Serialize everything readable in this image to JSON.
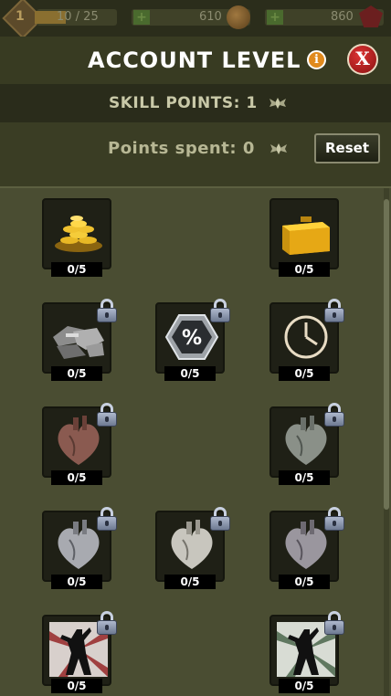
{
  "topbar": {
    "level": "1",
    "xp": "10 / 25",
    "coins": "610",
    "gems": "860"
  },
  "header": {
    "title": "ACCOUNT LEVEL",
    "info_glyph": "i",
    "close_glyph": "X"
  },
  "skill_points": {
    "label": "SKILL POINTS: 1"
  },
  "points_spent": {
    "label": "Points spent: 0",
    "reset_label": "Reset"
  },
  "skills": [
    {
      "icon": "gold-coins-icon",
      "count": "0/5",
      "locked": false
    },
    {
      "icon": "gold-crate-icon",
      "count": "0/5",
      "locked": false
    },
    {
      "icon": "scrap-metal-icon",
      "count": "0/5",
      "locked": true
    },
    {
      "icon": "percent-hexagon-icon",
      "count": "0/5",
      "locked": true
    },
    {
      "icon": "clock-icon",
      "count": "0/5",
      "locked": true
    },
    {
      "icon": "heart-bronze-icon",
      "count": "0/5",
      "locked": true
    },
    {
      "icon": "heart-gray-icon",
      "count": "0/5",
      "locked": true
    },
    {
      "icon": "heart-silver-icon",
      "count": "0/5",
      "locked": true
    },
    {
      "icon": "heart-white-icon",
      "count": "0/5",
      "locked": true
    },
    {
      "icon": "heart-dark-silver-icon",
      "count": "0/5",
      "locked": true
    },
    {
      "icon": "soldier-red-burst-icon",
      "count": "0/5",
      "locked": true
    },
    {
      "icon": "soldier-green-burst-icon",
      "count": "0/5",
      "locked": true
    }
  ],
  "colors": {
    "background": "#3a3d24",
    "panel": "#4a4d32",
    "tile": "#1f2016",
    "accent_orange": "#e08a1e",
    "close_red": "#c62020"
  }
}
